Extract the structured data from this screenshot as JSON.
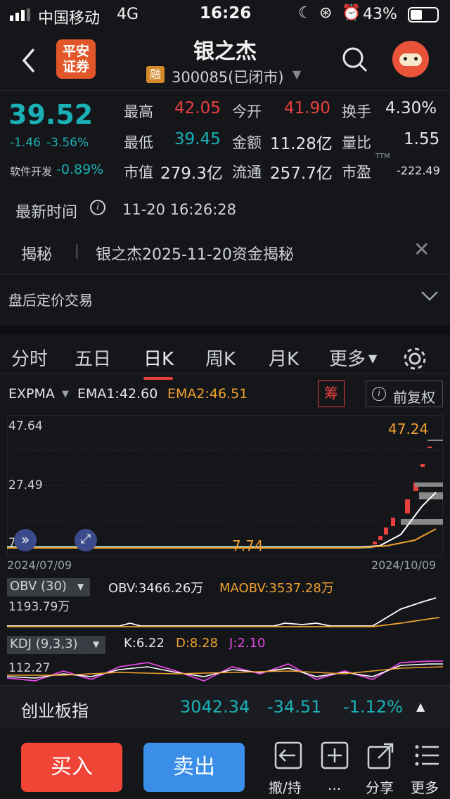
{
  "status": {
    "carrier": "中国移动",
    "network": "4G",
    "time": "16:26",
    "battery": "43%"
  },
  "header": {
    "title": "银之杰",
    "code": "300085(已闭市)",
    "badge": "融",
    "logo_line1": "平安",
    "logo_line2": "证券"
  },
  "quote": {
    "price": "39.52",
    "change": "-1.46",
    "change_pct": "-3.56%",
    "sector_name": "软件开发",
    "sector_pct": "-0.89%",
    "fields": [
      {
        "label": "最高",
        "value": "42.05"
      },
      {
        "label": "今开",
        "value": "41.90"
      },
      {
        "label": "换手",
        "value": "4.30%"
      },
      {
        "label": "最低",
        "value": "39.45"
      },
      {
        "label": "金额",
        "value": "11.28亿"
      },
      {
        "label": "量比",
        "value": "1.55"
      },
      {
        "label": "市值",
        "value": "279.3亿"
      },
      {
        "label": "流通",
        "value": "257.7亿"
      },
      {
        "label": "市盈",
        "value": "-222.49",
        "sup": "TTM"
      }
    ]
  },
  "latest": {
    "label": "最新时间",
    "value": "11-20 16:26:28"
  },
  "reveal": {
    "tag": "揭秘",
    "text": "银之杰2025-11-20资金揭秘"
  },
  "afterhours": {
    "label": "盘后定价交易"
  },
  "tabs": [
    "分时",
    "五日",
    "日K",
    "周K",
    "月K",
    "更多"
  ],
  "indicator": {
    "name": "EXPMA",
    "ema1": "EMA1:42.60",
    "ema2": "EMA2:46.51",
    "chip_btn": "筹",
    "adjust": "前复权"
  },
  "kchart": {
    "y_top": "47.64",
    "y_mid": "27.49",
    "y_low": "7.",
    "high_label": "47.24",
    "low_label": "7.74",
    "date_start": "2024/07/09",
    "date_end": "2024/10/09"
  },
  "obv": {
    "name": "OBV (30)",
    "obv": "OBV:3466.26万",
    "maobv": "MAOBV:3537.28万",
    "y_label": "1193.79万"
  },
  "kdj": {
    "name": "KDJ (9,3,3)",
    "k": "K:6.22",
    "d": "D:8.28",
    "j": "J:2.10",
    "y_label": "112.27"
  },
  "index": {
    "name": "创业板指",
    "value": "3042.34",
    "change": "-34.51",
    "pct": "-1.12%"
  },
  "bottom": {
    "buy": "买入",
    "sell": "卖出",
    "cancel": "撤/持",
    "more_dots": "...",
    "share": "分享",
    "more": "更多"
  },
  "colors": {
    "up": "#e8403e",
    "down": "#19b1b6",
    "ema2": "#f0a12e",
    "ema1": "#ffffff",
    "j_line": "#e347e0"
  }
}
